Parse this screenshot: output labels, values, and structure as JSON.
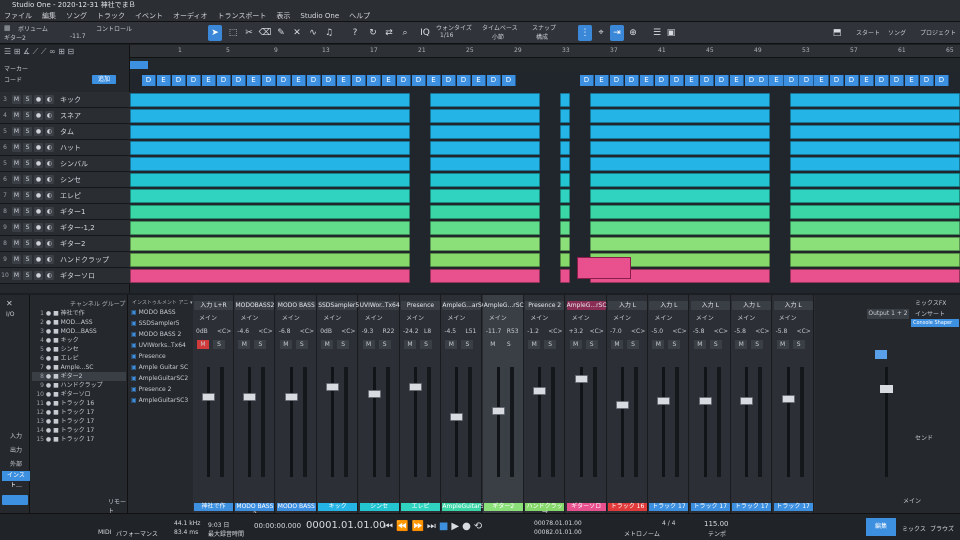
{
  "window": {
    "title": "Studio One - 2020-12-31 神社でまＢ"
  },
  "menu": [
    "ファイル",
    "編集",
    "ソング",
    "トラック",
    "イベント",
    "オーディオ",
    "トランスポート",
    "表示",
    "Studio One",
    "ヘルプ"
  ],
  "toolbar": {
    "inspector_label": "ボリューム",
    "track_label": "ギター2",
    "control_label": "コントロール",
    "value": "-11.7",
    "quantize_label": "ウォンタイズ",
    "quantize_value": "1/16",
    "timebase_label": "タイムベース",
    "timebase_value": "小節",
    "snap_label": "スナップ",
    "snap_value": "構成",
    "start_label": "スタート",
    "song_label": "ソング",
    "project_label": "プロジェクト"
  },
  "sidebar": {
    "marker_label": "マーカー",
    "chord_label": "コード",
    "chord_btn": "追加"
  },
  "ruler": [
    "1",
    "5",
    "9",
    "13",
    "17",
    "21",
    "25",
    "29",
    "33",
    "37",
    "41",
    "45",
    "49",
    "53",
    "57",
    "61",
    "65"
  ],
  "tracks": [
    {
      "num": "3",
      "name": "キック",
      "color": "#25b4e6"
    },
    {
      "num": "4",
      "name": "スネア",
      "color": "#25b4e6"
    },
    {
      "num": "5",
      "name": "タム",
      "color": "#25b4e6"
    },
    {
      "num": "6",
      "name": "ハット",
      "color": "#25b4e6"
    },
    {
      "num": "5",
      "name": "シンバル",
      "color": "#25b4e6"
    },
    {
      "num": "6",
      "name": "シンセ",
      "color": "#22c5d0"
    },
    {
      "num": "7",
      "name": "エレピ",
      "color": "#2fd3c0"
    },
    {
      "num": "8",
      "name": "ギター1",
      "color": "#3ad6a6"
    },
    {
      "num": "9",
      "name": "ギター-1,2",
      "color": "#60dc8a"
    },
    {
      "num": "8",
      "name": "ギター2",
      "color": "#8be07a"
    },
    {
      "num": "9",
      "name": "ハンドクラップ",
      "color": "#86d86a"
    },
    {
      "num": "10",
      "name": "ギターソロ",
      "color": "#e8508e"
    }
  ],
  "channels": [
    "神社で作",
    "MOD...ASS",
    "MOD...BASS",
    "キック",
    "シンセ",
    "エレピ",
    "Ample...SC",
    "ギター2",
    "ハンドクラップ",
    "ギターソロ",
    "トラック 16",
    "トラック 17",
    "トラック 17",
    "トラック 17",
    "トラック 17"
  ],
  "instruments": [
    "MODO BASS",
    "SSDSampler5",
    "MODO BASS 2",
    "UVIWorks..Tx64",
    "Presence",
    "Ample Guitar SC",
    "AmpleGuitarSC2",
    "Presence 2",
    "AmpleGuitarSC3"
  ],
  "strips": [
    {
      "name": "入力 L+R",
      "foot": "神社で作",
      "color": "#3d8fe0",
      "vol": "0dB",
      "pan": "<C>"
    },
    {
      "name": "MODOBASS2",
      "foot": "MODO BASS 2",
      "color": "#3d8fe0",
      "vol": "-4.6",
      "pan": "<C>"
    },
    {
      "name": "MODO BASS",
      "foot": "MODO BASS",
      "color": "#3d8fe0",
      "vol": "-6.8",
      "pan": "<C>"
    },
    {
      "name": "SSDSampler5",
      "foot": "キック",
      "color": "#25b4e6",
      "vol": "0dB",
      "pan": "<C>"
    },
    {
      "name": "UVIWor..Tx64",
      "foot": "シンセ",
      "color": "#22c5d0",
      "vol": "-9.3",
      "pan": "R22"
    },
    {
      "name": "Presence",
      "foot": "エレピ",
      "color": "#2fd3c0",
      "vol": "-24.2",
      "pan": "L8"
    },
    {
      "name": "AmpleG...arSC",
      "foot": "AmpleGuitarSC",
      "color": "#3ad6a6",
      "vol": "-4.5",
      "pan": "L51"
    },
    {
      "name": "AmpleG...rSC2",
      "foot": "ギター2",
      "color": "#8be07a",
      "vol": "-11.7",
      "pan": "R53"
    },
    {
      "name": "Presence 2",
      "foot": "ハンドクラップ",
      "color": "#86d86a",
      "vol": "-1.2",
      "pan": "<C>"
    },
    {
      "name": "AmpleG...rSC3",
      "foot": "ギターソロ",
      "color": "#e8508e",
      "vol": "+3.2",
      "pan": "<C>"
    },
    {
      "name": "入力 L",
      "foot": "トラック 16",
      "color": "#e03a3a",
      "vol": "-7.0",
      "pan": "<C>"
    },
    {
      "name": "入力 L",
      "foot": "トラック 17",
      "color": "#3d8fe0",
      "vol": "-5.0",
      "pan": "<C>"
    },
    {
      "name": "入力 L",
      "foot": "トラック 17",
      "color": "#3d8fe0",
      "vol": "-5.8",
      "pan": "<C>"
    },
    {
      "name": "入力 L",
      "foot": "トラック 17",
      "color": "#3d8fe0",
      "vol": "-5.8",
      "pan": "<C>"
    },
    {
      "name": "入力 L",
      "foot": "トラック 17",
      "color": "#3d8fe0",
      "vol": "-5.8",
      "pan": "<C>"
    }
  ],
  "right": {
    "output": "Output 1 + 2",
    "mixfx": "ミックスFX",
    "insert": "インサート",
    "console": "Console Shaper",
    "send": "センド",
    "main": "メイン"
  },
  "transport": {
    "midi": "MIDI",
    "perf": "パフォーマンス",
    "rate": "44.1 kHz",
    "latency": "83.4 ms",
    "time": "9:03 日",
    "time2": "最大録音時間",
    "position": "00:00:00.000",
    "bars": "00001.01.01.00",
    "loop_start": "00078.01.01.00",
    "loop_end": "00082.01.01.00",
    "sig": "4 / 4",
    "tempo": "115.00",
    "metro": "メトロノーム",
    "tempo_label": "テンポ",
    "edit": "編集",
    "mix": "ミックス",
    "browse": "ブラウズ"
  },
  "left_tabs": {
    "io": "I/O",
    "input": "入力",
    "output": "出力",
    "ext": "外部",
    "inst": "インスト…",
    "remote": "リモート"
  }
}
